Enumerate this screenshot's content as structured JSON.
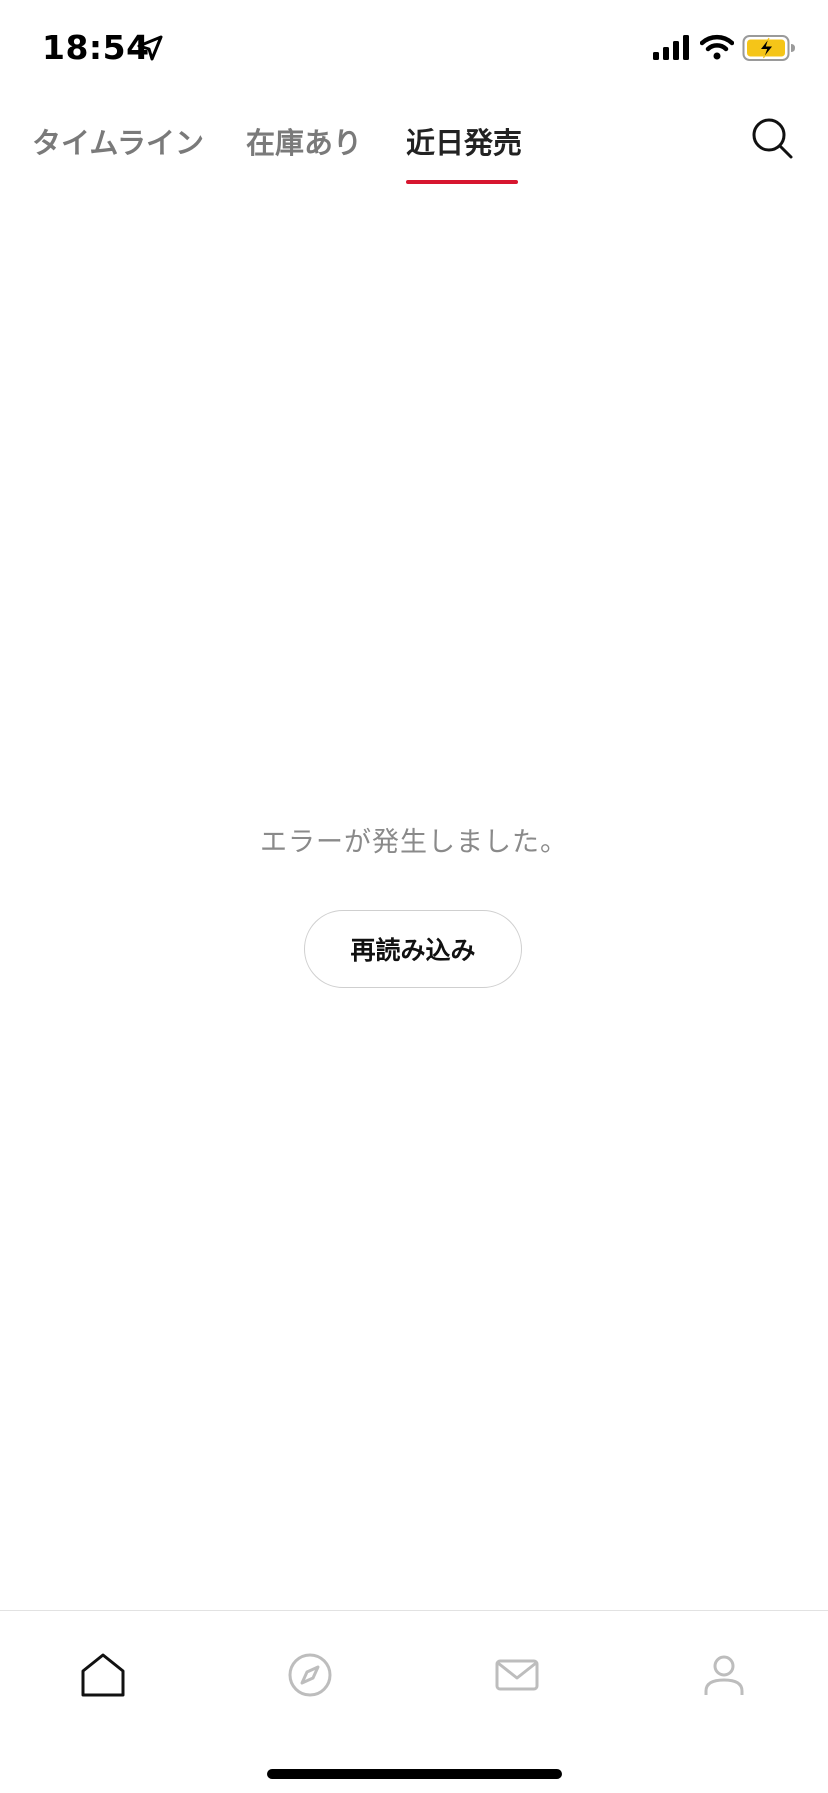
{
  "status_bar": {
    "time": "18:54"
  },
  "tabs": [
    {
      "label": "タイムライン",
      "active": false
    },
    {
      "label": "在庫あり",
      "active": false
    },
    {
      "label": "近日発売",
      "active": true
    }
  ],
  "accent_color": "#d7162f",
  "main": {
    "error_message": "エラーが発生しました。",
    "reload_label": "再読み込み"
  },
  "bottom_nav": {
    "items": [
      {
        "icon": "home-icon",
        "active": true
      },
      {
        "icon": "compass-icon",
        "active": false
      },
      {
        "icon": "mail-icon",
        "active": false
      },
      {
        "icon": "profile-icon",
        "active": false
      }
    ]
  }
}
